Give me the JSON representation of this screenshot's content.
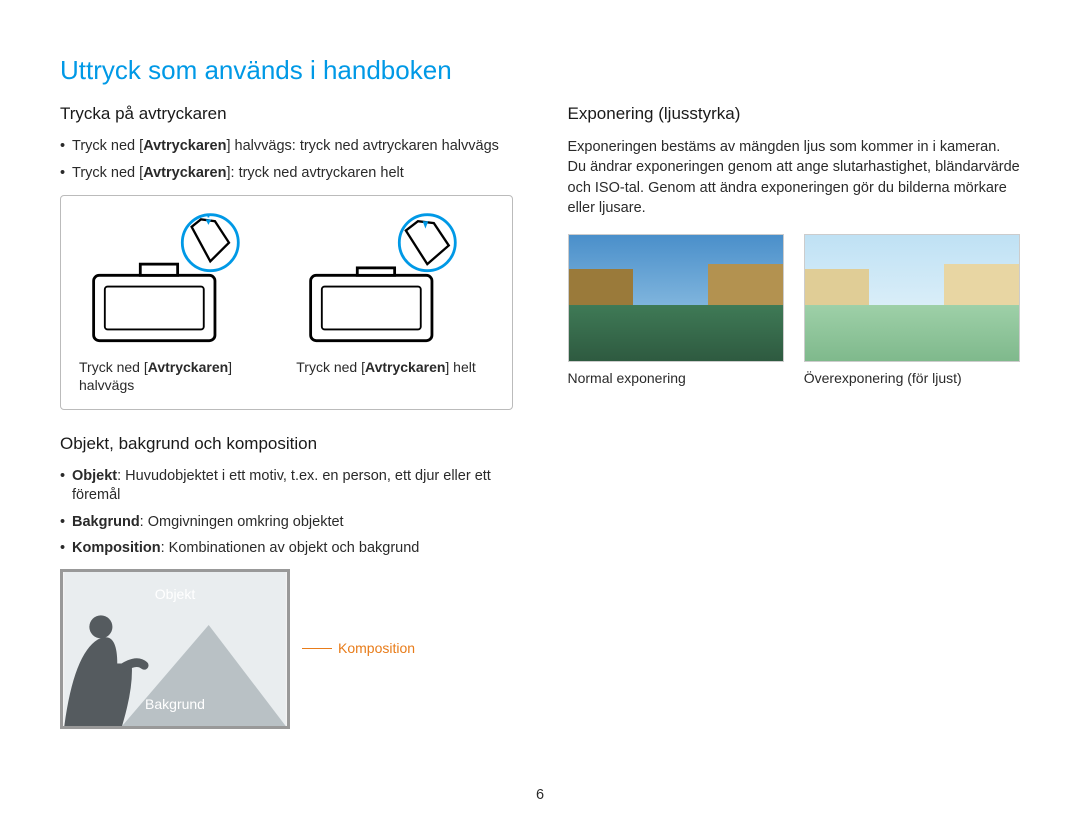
{
  "title": "Uttryck som används i handboken",
  "left": {
    "shutter": {
      "heading": "Trycka på avtryckaren",
      "bullet1_pre": "Tryck ned [",
      "bullet1_bold": "Avtryckaren",
      "bullet1_post": "] halvvägs: tryck ned avtryckaren halvvägs",
      "bullet2_pre": "Tryck ned [",
      "bullet2_bold": "Avtryckaren",
      "bullet2_post": "]: tryck ned avtryckaren helt",
      "fig1_pre": "Tryck ned [",
      "fig1_bold": "Avtryckaren",
      "fig1_post": "] halvvägs",
      "fig2_pre": "Tryck ned [",
      "fig2_bold": "Avtryckaren",
      "fig2_post": "] helt"
    },
    "composition": {
      "heading": "Objekt, bakgrund och komposition",
      "b1_bold": "Objekt",
      "b1_post": ": Huvudobjektet i ett motiv, t.ex. en person, ett djur eller ett föremål",
      "b2_bold": "Bakgrund",
      "b2_post": ": Omgivningen omkring objektet",
      "b3_bold": "Komposition",
      "b3_post": ": Kombinationen av objekt och bakgrund",
      "label_subject": "Objekt",
      "label_background": "Bakgrund",
      "label_composition": "Komposition"
    }
  },
  "right": {
    "exposure": {
      "heading": "Exponering (ljusstyrka)",
      "paragraph": "Exponeringen bestäms av mängden ljus som kommer in i kameran. Du ändrar exponeringen genom att ange slutarhastighet, bländarvärde och ISO-tal. Genom att ändra exponeringen gör du bilderna mörkare eller ljusare.",
      "caption_normal": "Normal exponering",
      "caption_over": "Överexponering (för ljust)"
    }
  },
  "page_number": "6"
}
